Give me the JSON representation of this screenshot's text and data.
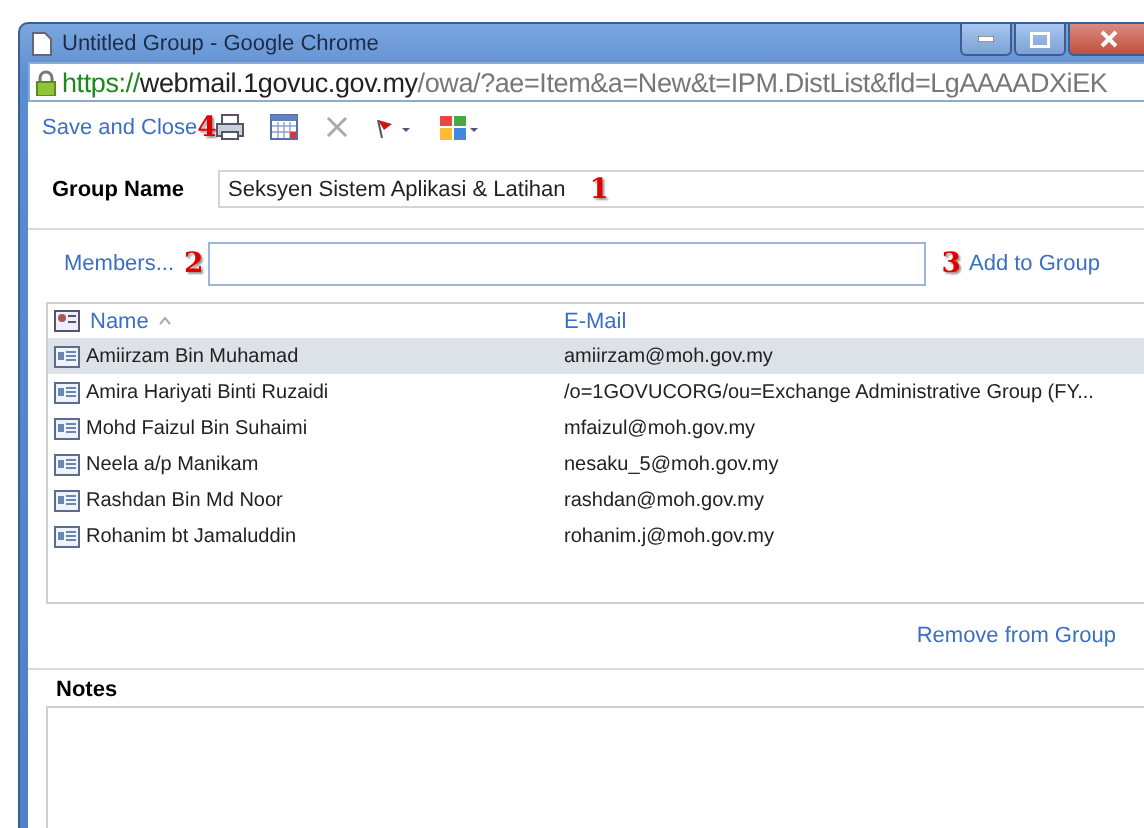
{
  "window": {
    "title": "Untitled Group - Google Chrome"
  },
  "address_bar": {
    "scheme": "https://",
    "host": "webmail.1govuc.gov.my",
    "path": "/owa/?ae=Item&a=New&t=IPM.DistList&fld=LgAAAADXiEK"
  },
  "toolbar": {
    "save_label": "Save and Close",
    "annotation": "4"
  },
  "group_name": {
    "label": "Group Name",
    "value": "Seksyen Sistem Aplikasi & Latihan",
    "annotation": "1"
  },
  "members": {
    "label": "Members...",
    "annotation": "2",
    "add_annotation": "3",
    "add_label": "Add to Group"
  },
  "table": {
    "columns": [
      "Name",
      "E-Mail"
    ],
    "rows": [
      {
        "name": "Amiirzam Bin Muhamad",
        "email": "amiirzam@moh.gov.my",
        "selected": true
      },
      {
        "name": "Amira Hariyati Binti Ruzaidi",
        "email": "/o=1GOVUCORG/ou=Exchange Administrative Group (FY...",
        "selected": false
      },
      {
        "name": "Mohd Faizul Bin Suhaimi",
        "email": "mfaizul@moh.gov.my",
        "selected": false
      },
      {
        "name": "Neela a/p Manikam",
        "email": "nesaku_5@moh.gov.my",
        "selected": false
      },
      {
        "name": "Rashdan Bin Md Noor",
        "email": "rashdan@moh.gov.my",
        "selected": false
      },
      {
        "name": "Rohanim bt Jamaluddin",
        "email": "rohanim.j@moh.gov.my",
        "selected": false
      }
    ]
  },
  "remove_label": "Remove from Group",
  "notes": {
    "label": "Notes"
  }
}
